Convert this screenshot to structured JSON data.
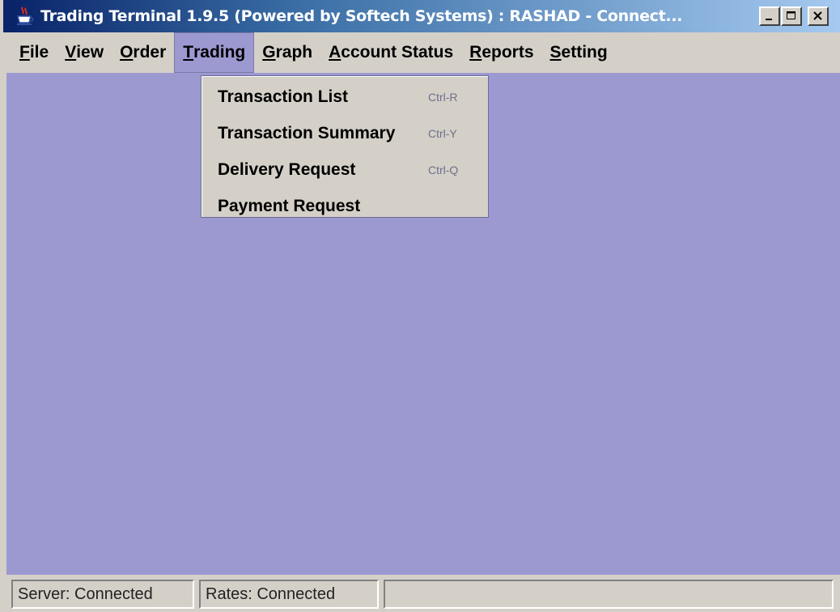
{
  "window": {
    "title": "Trading Terminal 1.9.5 (Powered by Softech Systems)   :   RASHAD - Connect...",
    "icon": "java-cup-icon",
    "controls": {
      "minimize": "minimize-icon",
      "maximize": "maximize-icon",
      "close": "close-icon"
    }
  },
  "menubar": {
    "items": [
      {
        "label": "File",
        "mnemonic": "F"
      },
      {
        "label": "View",
        "mnemonic": "V"
      },
      {
        "label": "Order",
        "mnemonic": "O"
      },
      {
        "label": "Trading",
        "mnemonic": "T",
        "active": true
      },
      {
        "label": "Graph",
        "mnemonic": "G"
      },
      {
        "label": "Account Status",
        "mnemonic": "A"
      },
      {
        "label": "Reports",
        "mnemonic": "R"
      },
      {
        "label": "Setting",
        "mnemonic": "S"
      }
    ]
  },
  "dropdown": {
    "items": [
      {
        "label": "Transaction List",
        "shortcut": "Ctrl-R"
      },
      {
        "label": "Transaction Summary",
        "shortcut": "Ctrl-Y"
      },
      {
        "label": "Delivery Request",
        "shortcut": "Ctrl-Q"
      },
      {
        "label": "Payment Request",
        "shortcut": ""
      }
    ]
  },
  "statusbar": {
    "server": "Server: Connected",
    "rates": "Rates: Connected",
    "extra": ""
  },
  "colors": {
    "titlebar_start": "#0a246a",
    "titlebar_end": "#a6caf0",
    "content_background": "#9c99d1",
    "menu_active": "#9c99d1",
    "chrome": "#d4d0c8"
  }
}
